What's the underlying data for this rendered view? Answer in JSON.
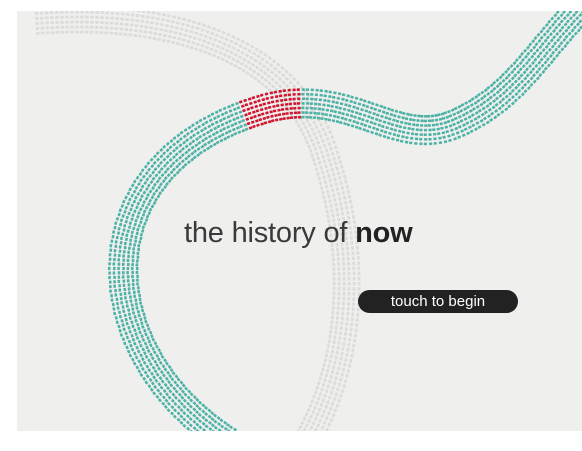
{
  "title": {
    "prefix": "the history of ",
    "emphasis": "now"
  },
  "start_button": {
    "label": "touch to begin"
  },
  "colors": {
    "background": "#efefee",
    "teal_ribbon": "#4db3a6",
    "red_highlight": "#d3152f",
    "grey_ribbon": "#dcdcda",
    "button": "#222222"
  }
}
